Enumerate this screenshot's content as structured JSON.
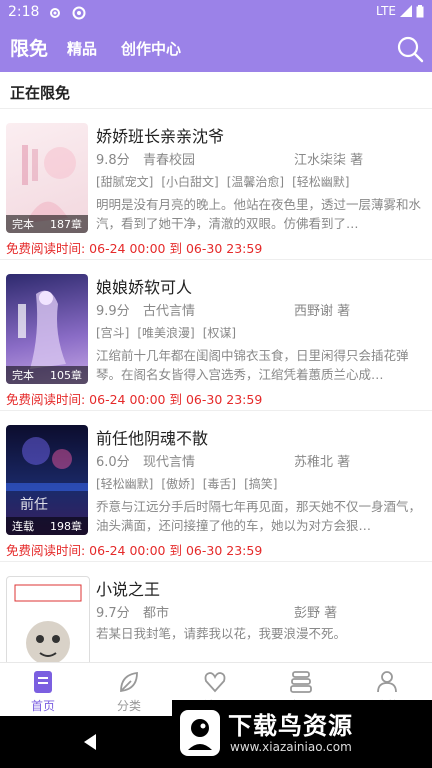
{
  "status": {
    "time": "2:18",
    "network": "LTE"
  },
  "header": {
    "tabs": [
      {
        "label": "限免"
      },
      {
        "label": "精品"
      },
      {
        "label": "创作中心"
      }
    ]
  },
  "section": {
    "title": "正在限免"
  },
  "books": [
    {
      "title": "娇娇班长亲亲沈爷",
      "rating": "9.8分",
      "category": "青春校园",
      "author": "江水柒柒 著",
      "tags": [
        "[甜腻宠文]",
        "[小白甜文]",
        "[温馨治愈]",
        "[轻松幽默]"
      ],
      "desc": "明明是没有月亮的晚上。他站在夜色里，透过一层薄雾和水汽，看到了她干净，清澈的双眼。仿佛看到了…",
      "status": "完本",
      "chapters": "187章",
      "free_time": "免费阅读时间: 06-24 00:00 到 06-30 23:59",
      "cover_color": "#f3dfe4"
    },
    {
      "title": "娘娘娇软可人",
      "rating": "9.9分",
      "category": "古代言情",
      "author": "西野谢 著",
      "tags": [
        "[宫斗]",
        "[唯美浪漫]",
        "[权谋]"
      ],
      "desc": "江绾前十几年都在闺阁中锦衣玉食，日里闲得只会插花弹琴。在阁名女皆得入宫选秀，江绾凭着蕙质兰心成…",
      "status": "完本",
      "chapters": "105章",
      "free_time": "免费阅读时间: 06-24 00:00 到 06-30 23:59",
      "cover_color": "#5b4a9e"
    },
    {
      "title": "前任他阴魂不散",
      "rating": "6.0分",
      "category": "现代言情",
      "author": "苏稚北 著",
      "tags": [
        "[轻松幽默]",
        "[傲娇]",
        "[毒舌]",
        "[搞笑]"
      ],
      "desc": "乔意与江远分手后时隔七年再见面，那天她不仅一身酒气，油头满面，还问接撞了他的车，她以为对方会狠…",
      "status": "连载",
      "chapters": "198章",
      "free_time": "免费阅读时间: 06-24 00:00 到 06-30 23:59",
      "cover_color": "#16184a"
    },
    {
      "title": "小说之王",
      "rating": "9.7分",
      "category": "都市",
      "author": "彭野 著",
      "tags": [],
      "desc": "若某日我封笔，请葬我以花，我要浪漫不死。",
      "status": "",
      "chapters": "",
      "free_time": "",
      "cover_color": "#ffffff"
    }
  ],
  "tabbar": {
    "items": [
      {
        "label": "首页",
        "icon": "book-home-icon",
        "active": true
      },
      {
        "label": "分类",
        "icon": "category-leaf-icon"
      },
      {
        "label": "社区",
        "icon": "community-heart-icon"
      },
      {
        "label": "书架",
        "icon": "bookshelf-icon"
      },
      {
        "label": "我的",
        "icon": "profile-icon"
      }
    ]
  },
  "watermark": {
    "title": "下载鸟资源",
    "url": "www.xiazainiao.com"
  },
  "colors": {
    "accent": "#9b82e8",
    "red": "#e52a2a",
    "active_tab": "#7b5fe0"
  }
}
